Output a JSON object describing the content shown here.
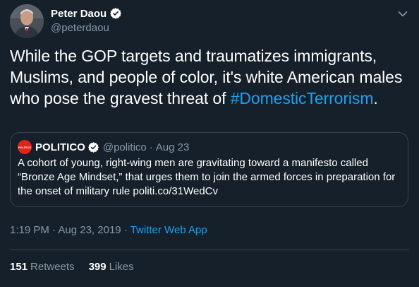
{
  "author": {
    "display_name": "Peter Daou",
    "handle": "@peterdaou",
    "verified": true,
    "avatar_icon": "person-photo-avatar"
  },
  "tweet": {
    "text_before": "While the GOP targets and traumatizes immigrants, Muslims, and people of color, it's white American males who pose the gravest threat of ",
    "hashtag": "#DomesticTerrorism",
    "text_after": "."
  },
  "quoted_tweet": {
    "avatar_label": "POLITICO",
    "display_name": "POLITICO",
    "verified": true,
    "handle": "@politico",
    "separator": "·",
    "date": "Aug 23",
    "text": "A cohort of young, right-wing men are gravitating toward a manifesto called “Bronze Age Mindset,” that urges them to join the armed forces in preparation for the onset of military rule politi.co/31WedCv"
  },
  "meta": {
    "time": "1:19 PM",
    "separator": "·",
    "date": "Aug 23, 2019",
    "source": "Twitter Web App"
  },
  "stats": {
    "retweets_count": "151",
    "retweets_label": "Retweets",
    "likes_count": "399",
    "likes_label": "Likes"
  },
  "colors": {
    "background": "#15202b",
    "link": "#1da1f2",
    "secondary_text": "#8899a6",
    "border": "#38444d",
    "politico_red": "#e2231a"
  }
}
